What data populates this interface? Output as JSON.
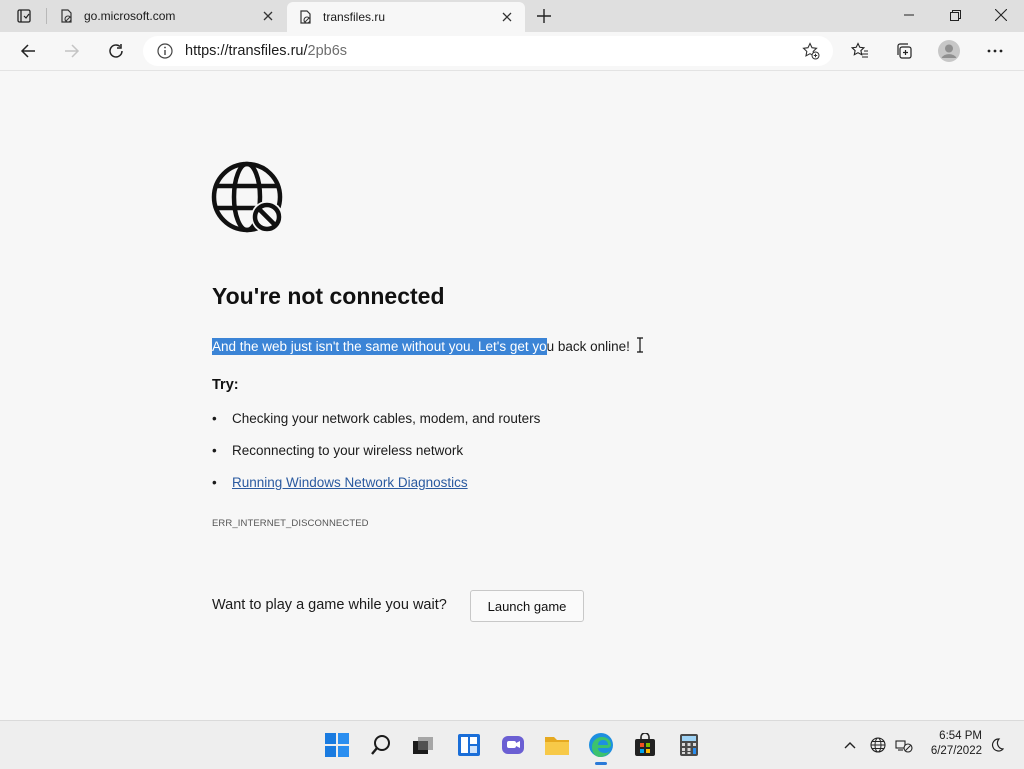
{
  "browser": {
    "tabs": [
      {
        "title": "go.microsoft.com",
        "active": false
      },
      {
        "title": "transfiles.ru",
        "active": true
      }
    ],
    "address": {
      "host": "https://transfiles.ru/",
      "path": "2pb6s"
    }
  },
  "error_page": {
    "heading": "You're not connected",
    "description_selected": "And the web just isn't the same without you. Let's get yo",
    "description_rest": "u back online!",
    "try_label": "Try:",
    "suggestions": [
      "Checking your network cables, modem, and routers",
      "Reconnecting to your wireless network"
    ],
    "diagnostics_link": "Running Windows Network Diagnostics",
    "bullet": "•",
    "error_code": "ERR_INTERNET_DISCONNECTED",
    "game_prompt": "Want to play a game while you wait?",
    "launch_button": "Launch game"
  },
  "taskbar": {
    "apps": [
      "windows-start",
      "search",
      "task-view",
      "widgets",
      "chat",
      "file-explorer",
      "edge",
      "store",
      "calculator"
    ],
    "active_app": "edge",
    "clock": {
      "time": "6:54 PM",
      "date": "6/27/2022"
    }
  },
  "colors": {
    "selection": "#3b84d6",
    "link": "#2a5aa0",
    "accent": "#2a7ad8"
  }
}
